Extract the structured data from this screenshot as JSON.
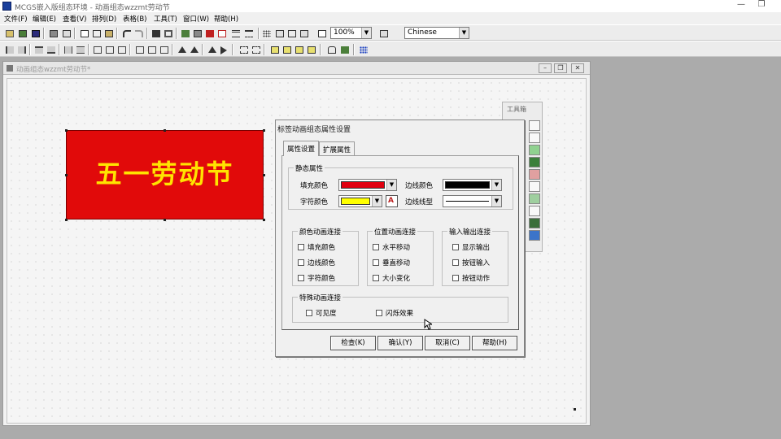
{
  "app": {
    "title": "MCGS嵌入版组态环境 - 动画组态wzzmt劳动节",
    "window_controls": [
      "—",
      "❐"
    ]
  },
  "menu": [
    "文件(F)",
    "编辑(E)",
    "查看(V)",
    "排列(D)",
    "表格(B)",
    "工具(T)",
    "窗口(W)",
    "帮助(H)"
  ],
  "toolbar": {
    "zoom": "100%",
    "language": "Chinese"
  },
  "document_window": {
    "title": "动画组态wzzmt劳动节*"
  },
  "canvas": {
    "label_text": "五一劳动节",
    "label_fill": "#e10a0a",
    "label_text_color": "#ffe400"
  },
  "toolbox": {
    "title": "工具箱"
  },
  "dialog": {
    "title": "标签动画组态属性设置",
    "tabs": [
      "属性设置",
      "扩展属性"
    ],
    "static_group": {
      "title": "静态属性",
      "fill_color_label": "填充颜色",
      "border_color_label": "边线颜色",
      "text_color_label": "字符颜色",
      "border_style_label": "边线线型",
      "fill_color": "#e10010",
      "border_color": "#000000",
      "text_color": "#ffff00"
    },
    "color_anim": {
      "title": "颜色动画连接",
      "items": [
        "填充颜色",
        "边线颜色",
        "字符颜色"
      ]
    },
    "pos_anim": {
      "title": "位置动画连接",
      "items": [
        "水平移动",
        "垂直移动",
        "大小变化"
      ]
    },
    "io_link": {
      "title": "输入输出连接",
      "items": [
        "显示输出",
        "按钮输入",
        "按钮动作"
      ]
    },
    "special_anim": {
      "title": "特殊动画连接",
      "items": [
        "可见度",
        "闪烁效果"
      ]
    },
    "buttons": {
      "check": "检查(K)",
      "ok": "确认(Y)",
      "cancel": "取消(C)",
      "help": "帮助(H)"
    }
  }
}
